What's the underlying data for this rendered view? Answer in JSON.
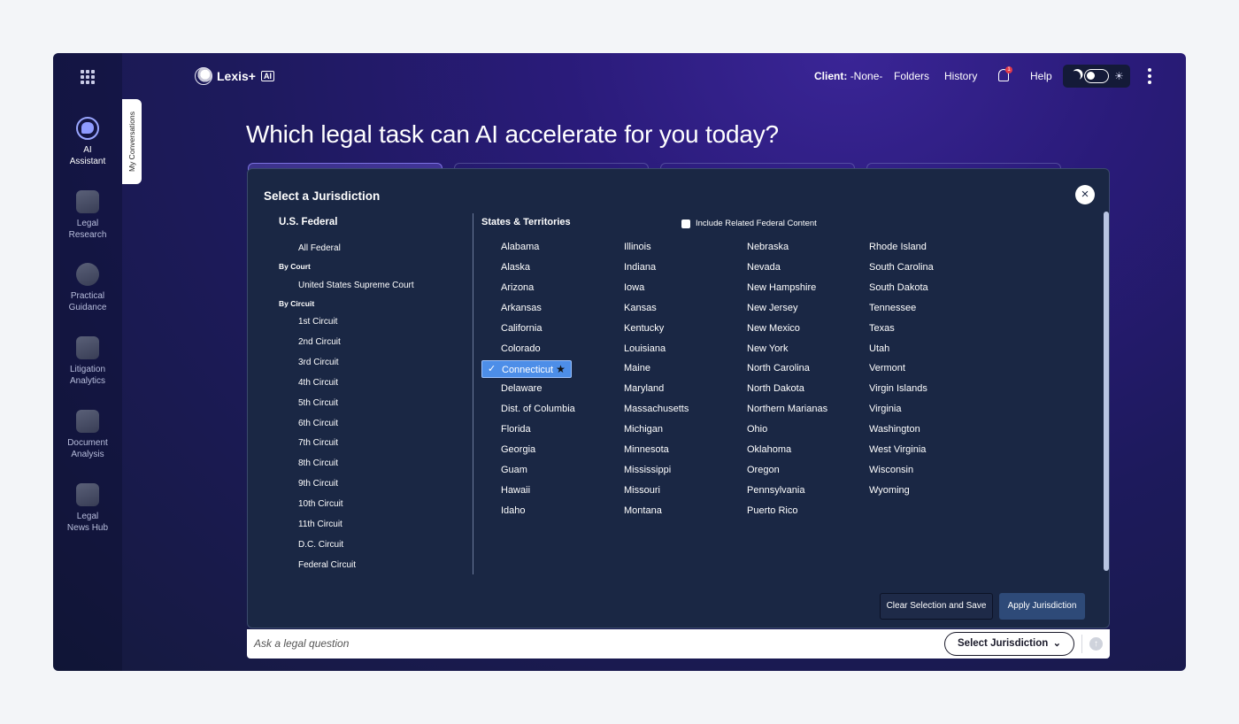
{
  "app": {
    "name": "Lexis+",
    "badge": "AI"
  },
  "rail": {
    "items": [
      {
        "label": "AI Assistant",
        "line1": "AI",
        "line2": "Assistant"
      },
      {
        "label": "Legal Research",
        "line1": "Legal",
        "line2": "Research"
      },
      {
        "label": "Practical Guidance",
        "line1": "Practical",
        "line2": "Guidance"
      },
      {
        "label": "Litigation Analytics",
        "line1": "Litigation",
        "line2": "Analytics"
      },
      {
        "label": "Document Analysis",
        "line1": "Document",
        "line2": "Analysis"
      },
      {
        "label": "Legal News Hub",
        "line1": "Legal",
        "line2": "News Hub"
      }
    ],
    "conversations_tab": "My Conversations"
  },
  "header": {
    "client_label": "Client:",
    "client_value": "-None-",
    "folders": "Folders",
    "history": "History",
    "notification_count": "1",
    "help": "Help"
  },
  "headline": "Which legal task can AI accelerate for you today?",
  "modal": {
    "title": "Select a Jurisdiction",
    "close": "×",
    "federal": {
      "heading": "U.S. Federal",
      "all": "All Federal",
      "by_court_label": "By Court",
      "supreme": "United States Supreme Court",
      "by_circuit_label": "By Circuit",
      "circuits": [
        "1st Circuit",
        "2nd Circuit",
        "3rd Circuit",
        "4th Circuit",
        "5th Circuit",
        "6th Circuit",
        "7th Circuit",
        "8th Circuit",
        "9th Circuit",
        "10th Circuit",
        "11th Circuit",
        "D.C. Circuit",
        "Federal Circuit"
      ]
    },
    "states_heading": "States & Territories",
    "include_related": "Include Related Federal Content",
    "selected_state": "Connecticut",
    "states_columns": [
      [
        "Alabama",
        "Alaska",
        "Arizona",
        "Arkansas",
        "California",
        "Colorado",
        "Connecticut",
        "Delaware",
        "Dist. of Columbia",
        "Florida",
        "Georgia",
        "Guam",
        "Hawaii",
        "Idaho"
      ],
      [
        "Illinois",
        "Indiana",
        "Iowa",
        "Kansas",
        "Kentucky",
        "Louisiana",
        "Maine",
        "Maryland",
        "Massachusetts",
        "Michigan",
        "Minnesota",
        "Mississippi",
        "Missouri",
        "Montana"
      ],
      [
        "Nebraska",
        "Nevada",
        "New Hampshire",
        "New Jersey",
        "New Mexico",
        "New York",
        "North Carolina",
        "North Dakota",
        "Northern Marianas",
        "Ohio",
        "Oklahoma",
        "Oregon",
        "Pennsylvania",
        "Puerto Rico"
      ],
      [
        "Rhode Island",
        "South Carolina",
        "South Dakota",
        "Tennessee",
        "Texas",
        "Utah",
        "Vermont",
        "Virgin Islands",
        "Virginia",
        "Washington",
        "West Virginia",
        "Wisconsin",
        "Wyoming"
      ]
    ],
    "clear_button": "Clear Selection and Save",
    "apply_button": "Apply Jurisdiction"
  },
  "askbar": {
    "placeholder": "Ask a legal question",
    "jurisdiction_button": "Select Jurisdiction"
  }
}
